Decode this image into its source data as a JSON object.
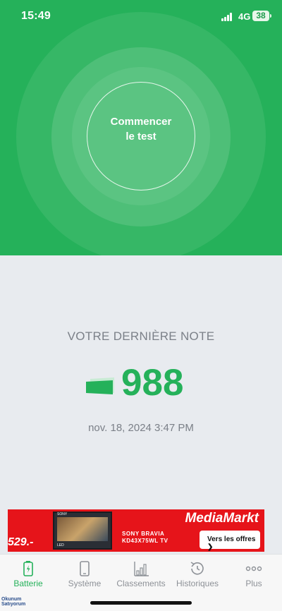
{
  "status_bar": {
    "time": "15:49",
    "network": "4G",
    "battery_level": "38"
  },
  "hero": {
    "start_line1": "Commencer",
    "start_line2": "le test"
  },
  "score": {
    "title": "VOTRE DERNIÈRE NOTE",
    "value": "988",
    "date": "nov. 18, 2024 3:47 PM"
  },
  "ad": {
    "price": "529.-",
    "tv_brand": "SONY",
    "tv_tag": "LED",
    "product_line1": "SONY BRAVIA",
    "product_line2": "KD43X75WL TV",
    "store": "MediaMarkt",
    "cta": "Vers les offres ❯"
  },
  "tabs": [
    {
      "label": "Batterie",
      "icon": "battery-icon",
      "active": true
    },
    {
      "label": "Système",
      "icon": "phone-icon",
      "active": false
    },
    {
      "label": "Classements",
      "icon": "bar-chart-icon",
      "active": false
    },
    {
      "label": "Historiques",
      "icon": "history-icon",
      "active": false
    },
    {
      "label": "Plus",
      "icon": "more-icon",
      "active": false
    }
  ],
  "watermark": {
    "line1": "Okunum",
    "line2": "Satıyorum"
  },
  "colors": {
    "brand_green": "#25b15a",
    "ad_red": "#e6141a",
    "muted_text": "#7b8088"
  }
}
